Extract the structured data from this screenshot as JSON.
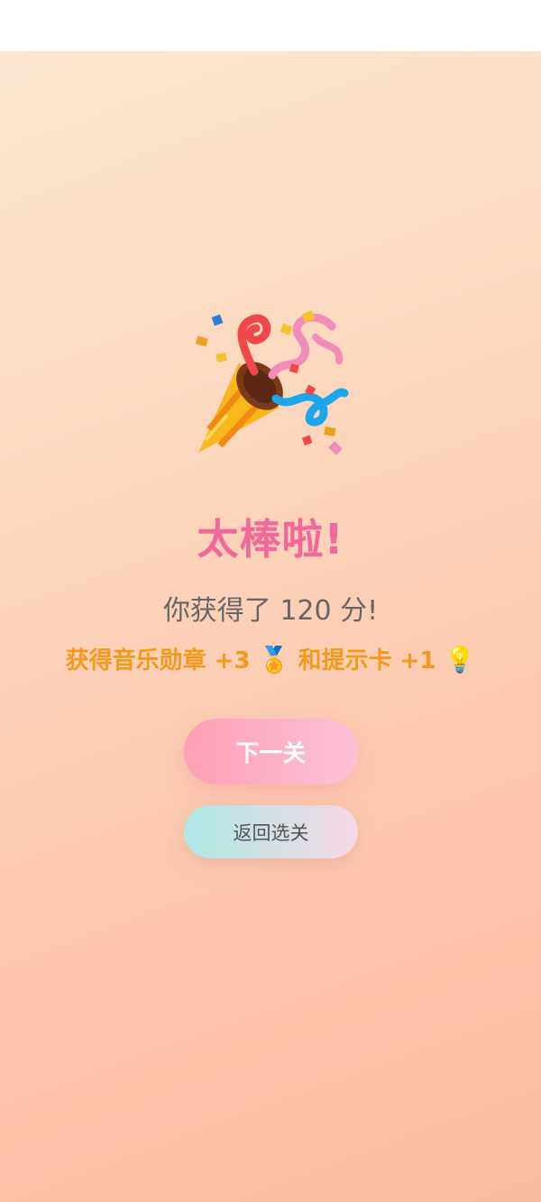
{
  "result": {
    "title": "太棒啦!",
    "score_text": "你获得了 120 分!",
    "reward": {
      "medal_text": "获得音乐勋章 +3",
      "medal_emoji": "🏅",
      "hint_text": "和提示卡 +1",
      "hint_emoji": "💡"
    }
  },
  "buttons": {
    "next_label": "下一关",
    "back_label": "返回选关"
  },
  "icons": {
    "hero": "party-popper-icon",
    "medal": "medal-icon",
    "hint": "lightbulb-icon"
  },
  "colors": {
    "title": "#f2689a",
    "reward": "#f39a1c",
    "score": "#666666",
    "background_start": "#fde7d0",
    "background_end": "#fbb9a0"
  }
}
